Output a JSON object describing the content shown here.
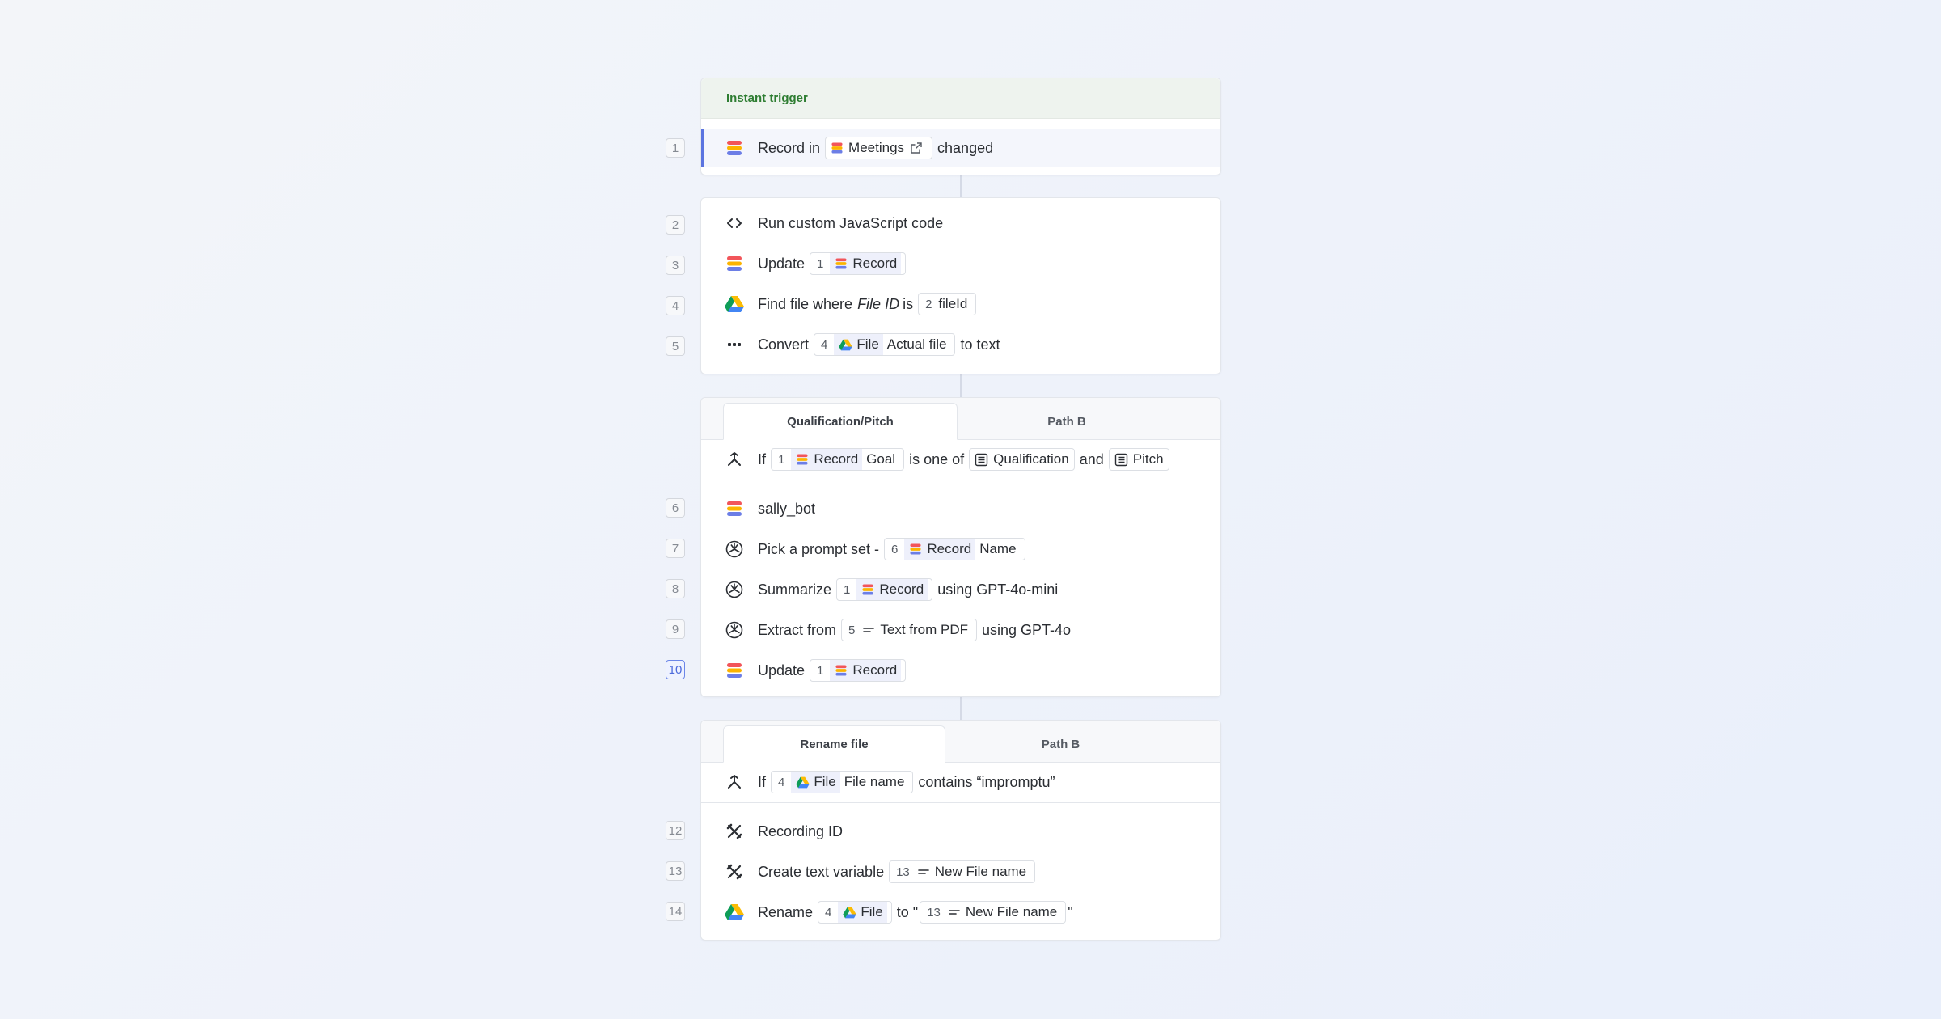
{
  "trigger": {
    "header": "Instant trigger",
    "step": {
      "num": "1",
      "pre": "Record in",
      "table": "Meetings",
      "post": "changed"
    }
  },
  "block2": {
    "steps": [
      {
        "num": "2",
        "icon": "code-icon",
        "text": "Run custom JavaScript code"
      },
      {
        "num": "3",
        "icon": "stack-icon",
        "pre": "Update",
        "ref_num": "1",
        "ref_label": "Record"
      },
      {
        "num": "4",
        "icon": "google-drive-icon",
        "pre": "Find file where",
        "field": "File ID",
        "mid": "is",
        "ref_num": "2",
        "ref_label": "fileId"
      },
      {
        "num": "5",
        "icon": "dots-icon",
        "pre": "Convert",
        "ref_num": "4",
        "ref_label": "File",
        "ref_field": "Actual file",
        "post": "to text"
      }
    ]
  },
  "branch1": {
    "tabs": [
      "Qualification/Pitch",
      "Path B"
    ],
    "condition": {
      "pre": "If",
      "ref_num": "1",
      "ref_label": "Record",
      "ref_field": "Goal",
      "mid": "is one of",
      "opt1": "Qualification",
      "and": "and",
      "opt2": "Pitch"
    },
    "steps": [
      {
        "num": "6",
        "icon": "stack-icon",
        "text": "sally_bot"
      },
      {
        "num": "7",
        "icon": "openai-icon",
        "pre": "Pick a prompt set -",
        "ref_num": "6",
        "ref_label": "Record",
        "ref_field": "Name"
      },
      {
        "num": "8",
        "icon": "openai-icon",
        "pre": "Summarize",
        "ref_num": "1",
        "ref_label": "Record",
        "post": "using GPT-4o-mini"
      },
      {
        "num": "9",
        "icon": "openai-icon",
        "pre": "Extract from",
        "ref_num": "5",
        "ref_label": "Text from PDF",
        "post": "using GPT-4o"
      },
      {
        "num": "10",
        "icon": "stack-icon",
        "pre": "Update",
        "ref_num": "1",
        "ref_label": "Record"
      }
    ]
  },
  "branch2": {
    "tabs": [
      "Rename file",
      "Path B"
    ],
    "condition": {
      "pre": "If",
      "ref_num": "4",
      "ref_label": "File",
      "ref_field": "File name",
      "post": "contains “impromptu”"
    },
    "steps": [
      {
        "num": "12",
        "icon": "tools-icon",
        "text": "Recording ID"
      },
      {
        "num": "13",
        "icon": "tools-icon",
        "pre": "Create text variable",
        "ref_num": "13",
        "ref_label": "New File name"
      },
      {
        "num": "14",
        "icon": "google-drive-icon",
        "pre": "Rename",
        "ref_num": "4",
        "ref_label": "File",
        "mid": "to \"",
        "ref2_num": "13",
        "ref2_label": "New File name",
        "post": "\""
      }
    ]
  },
  "colors": {
    "accent": "#5b74e0",
    "trigger_text": "#2e7d32",
    "trigger_bg": "#eef3ee"
  }
}
